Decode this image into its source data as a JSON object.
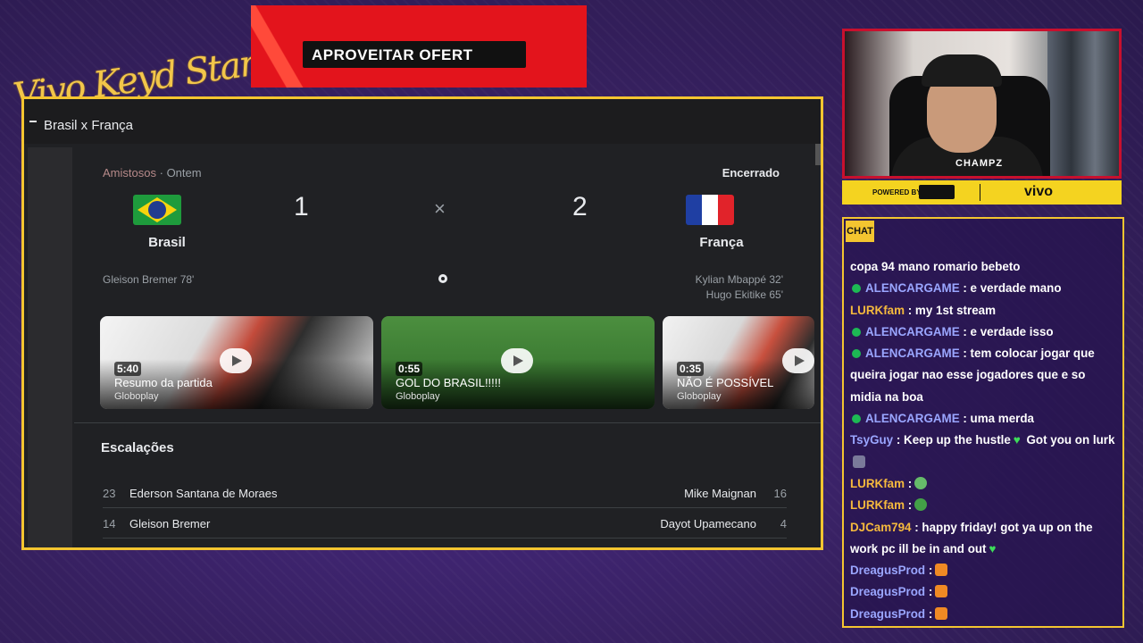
{
  "brand": {
    "text": "Vivo Keyd Stars"
  },
  "ad": {
    "button_label": "APROVEITAR OFERT"
  },
  "browser": {
    "title": "Brasil x França",
    "match": {
      "league": "Amistosos",
      "separator": "·",
      "when": "Ontem",
      "status": "Encerrado",
      "home": {
        "name": "Brasil",
        "score": "1",
        "scorers": [
          "Gleison Bremer 78'"
        ]
      },
      "away": {
        "name": "França",
        "score": "2",
        "scorers": [
          "Kylian Mbappé 32'",
          "Hugo Ekitike 65'"
        ]
      },
      "vs_symbol": "×"
    },
    "videos": [
      {
        "duration": "5:40",
        "title": "Resumo da partida",
        "source": "Globoplay"
      },
      {
        "duration": "0:55",
        "title": "GOL DO BRASIL!!!!!",
        "source": "Globoplay"
      },
      {
        "duration": "0:35",
        "title": "NÃO É POSSÍVEL",
        "source": "Globoplay"
      }
    ],
    "lineups": {
      "title": "Escalações",
      "rows": [
        {
          "home_num": "23",
          "home_name": "Ederson Santana de Moraes",
          "away_name": "Mike Maignan",
          "away_num": "16"
        },
        {
          "home_num": "14",
          "home_name": "Gleison Bremer",
          "away_name": "Dayot Upamecano",
          "away_num": "4"
        }
      ]
    }
  },
  "webcam": {
    "overlay_logo": "CHAMPZ"
  },
  "sponsor_bar": {
    "powered_by": "POWERED BY",
    "vivo": "vivo"
  },
  "chat": {
    "tab_label": "CHAT",
    "messages": [
      {
        "user": "",
        "text": "copa 94 mano romario bebeto"
      },
      {
        "user": "ALENCARGAME",
        "text": ": e verdade mano"
      },
      {
        "user": "LURKfam",
        "text": ": my 1st stream"
      },
      {
        "user": "ALENCARGAME",
        "text": ": e verdade isso"
      },
      {
        "user": "ALENCARGAME",
        "text": ": tem colocar jogar que queira jogar nao esse jogadores que e so midia na boa"
      },
      {
        "user": "ALENCARGAME",
        "text": ": uma merda"
      },
      {
        "user": "TsyGuy",
        "text": ": Keep up the hustle",
        "text2": " Got you on lurk"
      },
      {
        "user": "LURKfam",
        "text": ":"
      },
      {
        "user": "LURKfam",
        "text": ":"
      },
      {
        "user": "DJCam794",
        "text": ": happy friday! got ya up on the work pc ill be in and out"
      },
      {
        "user": "DreagusProd",
        "text": ":"
      },
      {
        "user": "DreagusProd",
        "text": ":"
      },
      {
        "user": "DreagusProd",
        "text": ":"
      }
    ]
  },
  "colors": {
    "frame_border": "#f4c530",
    "ad_red": "#e3141c",
    "bg_purple": "#36205f"
  }
}
